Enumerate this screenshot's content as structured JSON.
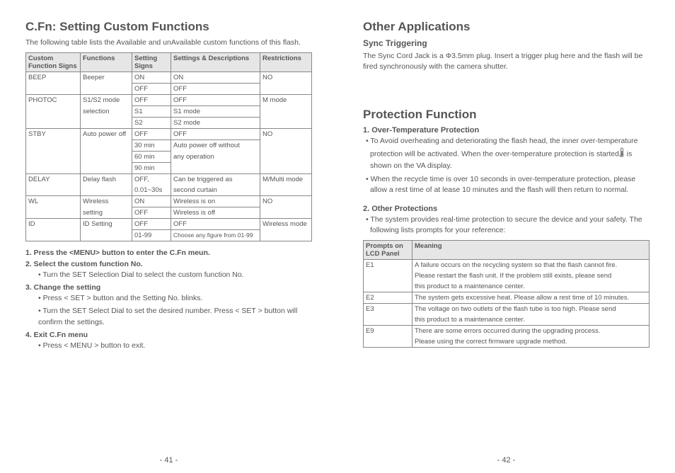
{
  "left": {
    "title": "C.Fn: Setting Custom Functions",
    "intro": "The following table lists the Available and unAvailable custom functions of this flash.",
    "table_headers": {
      "c1": "Custom Function Signs",
      "c2": "Functions",
      "c3": "Setting Signs",
      "c4": "Settings & Descriptions",
      "c5": "Restrictions"
    },
    "rows": {
      "beep": {
        "sign": "BEEP",
        "fn": "Beeper",
        "s1": "ON",
        "d1": "ON",
        "s2": "OFF",
        "d2": "OFF",
        "r": "NO"
      },
      "photoc": {
        "sign": "PHOTOC",
        "fn1": "S1/S2 mode",
        "fn2": "selection",
        "s1": "OFF",
        "d1": "OFF",
        "s2": "S1",
        "d2": "S1 mode",
        "s3": "S2",
        "d3": "S2 mode",
        "r": "M mode"
      },
      "stby": {
        "sign": "STBY",
        "fn": "Auto power off",
        "s1": "OFF",
        "d1": "OFF",
        "s2": "30 min",
        "d2": "Auto power off without",
        "s3": "60 min",
        "d3": "any operation",
        "s4": "90 min",
        "d4": "",
        "r": "NO"
      },
      "delay": {
        "sign": "DELAY",
        "fn": "Delay flash",
        "s1": "OFF,",
        "s2": "0.01~30s",
        "d1": "Can be triggered as",
        "d2": "second curtain",
        "r": "M/Multi mode"
      },
      "wl": {
        "sign": "WL",
        "fn1": "Wireless",
        "fn2": "setting",
        "s1": "ON",
        "d1": "Wireless is on",
        "s2": "OFF",
        "d2": "Wireless is off",
        "r": "NO"
      },
      "id": {
        "sign": "ID",
        "fn": "ID Setting",
        "s1": "OFF",
        "d1": "OFF",
        "s2": "01-99",
        "d2": "Choose any figure from 01-99",
        "r": "Wireless mode"
      }
    },
    "steps": {
      "s1": "1. Press the <MENU> button to enter the C.Fn meun.",
      "s2": "2. Select the custom function No.",
      "s2a": "• Turn the SET Selection Dial to select the custom function No.",
      "s3": "3. Change the setting",
      "s3a": "• Press < SET > button and the Setting No. blinks.",
      "s3b": "• Turn the SET Select Dial to set the desired number. Press < SET > button will confirm the settings.",
      "s4": "4. Exit C.Fn menu",
      "s4a": "• Press < MENU > button to exit."
    },
    "footer": "-  41  -"
  },
  "right": {
    "title1": "Other Applications",
    "sync_h": "Sync Triggering",
    "sync_body": "The Sync Cord Jack is a Φ3.5mm plug. Insert a trigger plug here and the flash will be fired synchronously with the camera shutter.",
    "title2": "Protection Function",
    "ot_h": "1. Over-Temperature Protection",
    "ot_b1a": "• To Avoid overheating and deteriorating the flash head, the inner over-temperature protection will be activated. When the over-temperature protection is started, ",
    "ot_b1b": " is shown on the VA display.",
    "ot_b2": "• When the recycle time is over 10 seconds in over-temperature protection, please allow a rest time of at lease 10 minutes and the flash will then return to normal.",
    "op_h": "2. Other Protections",
    "op_intro": "• The system provides real-time protection to secure the device and your safety. The following lists prompts for your reference:",
    "th1": "Prompts on LCD Panel",
    "th2": "Meaning",
    "e1": {
      "code": "E1",
      "m1": "A failure occurs on the recycling system so that the flash cannot fire.",
      "m2": "Please restart the flash unit. If the problem still exists, please send",
      "m3": "this product to a maintenance center."
    },
    "e2": {
      "code": "E2",
      "m": "The system gets excessive heat. Please allow a rest time of 10 minutes."
    },
    "e3": {
      "code": "E3",
      "m1": "The voltage on two outlets of the flash tube is too high. Please send",
      "m2": " this product to a maintenance center."
    },
    "e9": {
      "code": "E9",
      "m1": "There are some errors occurred during the upgrading process.",
      "m2": "Please using the correct firmware upgrade method."
    },
    "footer": "-  42  -"
  }
}
